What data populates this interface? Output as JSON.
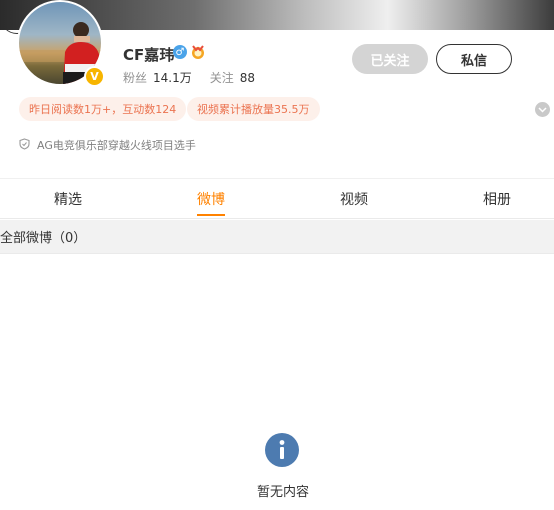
{
  "profile": {
    "name": "CF嘉玮",
    "verified_badge": "V",
    "gender_icon": "male-icon",
    "stats": {
      "fans_label": "粉丝",
      "fans_value": "14.1万",
      "follow_label": "关注",
      "follow_value": "88"
    },
    "description": "AG电竞俱乐部穿越火线项目选手"
  },
  "actions": {
    "followed_label": "已关注",
    "message_label": "私信",
    "more_icon": "more-dots-icon"
  },
  "tags": [
    {
      "label": "昨日阅读数1万+，互动数124"
    },
    {
      "label": "视频累计播放量35.5万"
    }
  ],
  "tabs": [
    {
      "label": "精选"
    },
    {
      "label": "微博",
      "active": true
    },
    {
      "label": "视频"
    },
    {
      "label": "相册"
    }
  ],
  "feed": {
    "header": "全部微博（0）",
    "empty_text": "暂无内容"
  },
  "colors": {
    "accent": "#ff8200",
    "tag_text": "#eb7350",
    "tag_bg": "#fdf0ea",
    "empty_icon": "#4d7bb0"
  }
}
